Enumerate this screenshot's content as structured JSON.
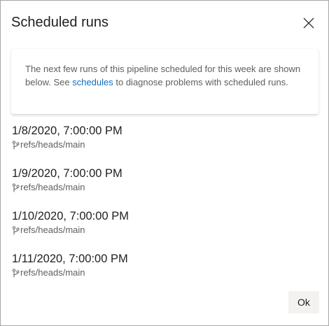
{
  "dialog": {
    "title": "Scheduled runs",
    "close_icon": "close-icon",
    "info": {
      "text_before": "The next few runs of this pipeline scheduled for this week are shown below. See ",
      "link_text": "schedules",
      "text_after": " to diagnose problems with scheduled runs."
    },
    "runs": [
      {
        "datetime": "1/8/2020, 7:00:00 PM",
        "branch": "refs/heads/main"
      },
      {
        "datetime": "1/9/2020, 7:00:00 PM",
        "branch": "refs/heads/main"
      },
      {
        "datetime": "1/10/2020, 7:00:00 PM",
        "branch": "refs/heads/main"
      },
      {
        "datetime": "1/11/2020, 7:00:00 PM",
        "branch": "refs/heads/main"
      }
    ],
    "branch_icon": "git-branch-icon",
    "ok_label": "Ok",
    "colors": {
      "link": "#106ebe",
      "secondary_text": "#605e5c",
      "button_bg": "#f3f2f1"
    }
  }
}
